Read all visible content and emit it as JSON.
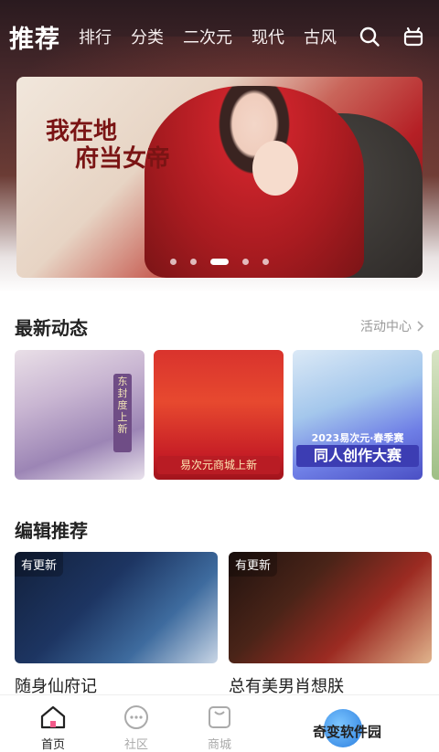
{
  "header": {
    "main_tab": "推荐",
    "tabs": [
      "排行",
      "分类",
      "二次元",
      "现代",
      "古风"
    ],
    "icons": [
      "search-icon",
      "gift-box-icon"
    ]
  },
  "banner": {
    "art_title": "我在地府当女帝",
    "page_count": 5,
    "active_index": 2
  },
  "latest_news": {
    "title": "最新动态",
    "more_label": "活动中心",
    "cards": [
      {
        "ribbon_text": "东封度上新"
      },
      {
        "footer_text": "易次元商城上新"
      },
      {
        "year_text": "2023易次元·春季赛",
        "big_text": "同人创作大赛"
      }
    ]
  },
  "editor_picks": {
    "title": "编辑推荐",
    "items": [
      {
        "badge": "有更新",
        "name": "随身仙府记"
      },
      {
        "badge": "有更新",
        "name": "总有美男肖想朕"
      }
    ]
  },
  "tabbar": {
    "items": [
      {
        "label": "首页",
        "icon": "home-icon",
        "active": true
      },
      {
        "label": "社区",
        "icon": "community-icon",
        "active": false
      },
      {
        "label": "商城",
        "icon": "shop-icon",
        "active": false
      }
    ]
  },
  "watermark": {
    "text": "奇变软件园"
  },
  "colors": {
    "accent": "#222222",
    "inactive": "#aaaaaa",
    "header_bg": "#4a2a2c"
  }
}
